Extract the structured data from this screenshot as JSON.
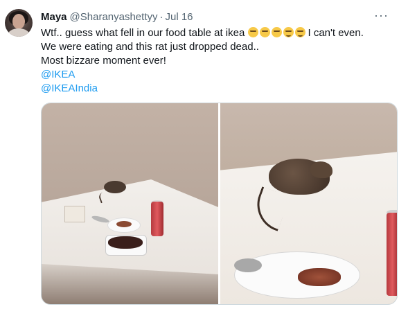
{
  "tweet": {
    "author_name": "Maya",
    "author_handle": "@Sharanyashettyy",
    "separator": "·",
    "date": "Jul 16",
    "more_menu": "···",
    "line1_before_emoji": "Wtf.. guess what fell in our food table at ikea ",
    "line1_after_emoji": "I can't even.",
    "line2": "We were eating and this rat just dropped dead..",
    "line3": "Most bizzare moment ever!",
    "mention1": "@IKEA",
    "mention2": "@IKEAIndia",
    "emojis": [
      "unamused-face",
      "unamused-face",
      "unamused-face",
      "woozy-face",
      "woozy-face"
    ]
  },
  "colors": {
    "link": "#1d9bf0",
    "secondary_text": "#536471",
    "primary_text": "#0f1419"
  }
}
